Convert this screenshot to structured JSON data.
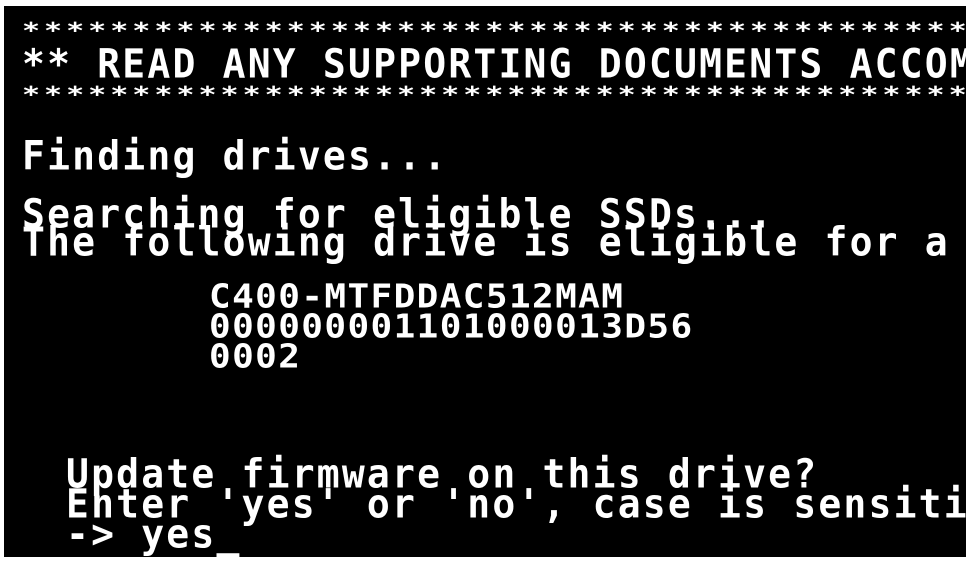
{
  "terminal": {
    "banner_top": "*****************************************************",
    "banner_text": "** READ ANY SUPPORTING DOCUMENTS ACCOMPANYING",
    "banner_bottom": "*****************************************************",
    "finding": "Finding drives...",
    "searching": "Searching for eligible SSDs...",
    "eligible": "The following drive is eligible for a firmware",
    "drive_model": "C400-MTFDDAC512MAM",
    "drive_serial": "000000001101000013D56",
    "drive_rev": "0002",
    "prompt_question": "Update firmware on this drive?",
    "prompt_instruction": "Enter 'yes' or 'no', case is sensitive",
    "prompt_arrow": "-> ",
    "input_value": "yes",
    "cursor": "_",
    "colors": {
      "background": "#000000",
      "text": "#ffffff"
    }
  }
}
